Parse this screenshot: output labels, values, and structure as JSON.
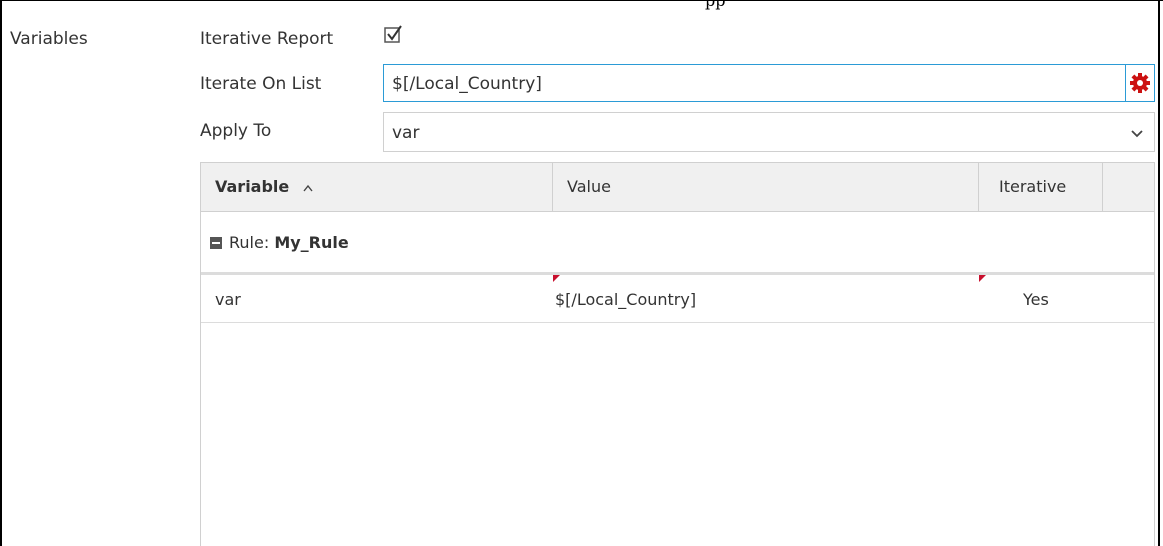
{
  "page_header": {
    "cut_text": "pp"
  },
  "section": {
    "label": "Variables"
  },
  "iterative_report": {
    "label": "Iterative Report",
    "checked": true
  },
  "iterate_on_list": {
    "label": "Iterate On List",
    "value": "$[/Local_Country]",
    "button_icon": "gear-icon",
    "button_color": "#cc1111"
  },
  "apply_to": {
    "label": "Apply To",
    "value": "var"
  },
  "grid": {
    "columns": [
      {
        "label": "Variable",
        "sort": "ascending"
      },
      {
        "label": "Value"
      },
      {
        "label": "Iterative"
      },
      {
        "label": ""
      }
    ],
    "group": {
      "prefix": "Rule:",
      "name": "My_Rule"
    },
    "rows": [
      {
        "variable": "var",
        "value": "$[/Local_Country]",
        "iterative": "Yes"
      }
    ]
  },
  "colors": {
    "accent": "#2b9bd6",
    "dirty_marker": "#c8102e",
    "header_bg": "#f0f0f0"
  }
}
